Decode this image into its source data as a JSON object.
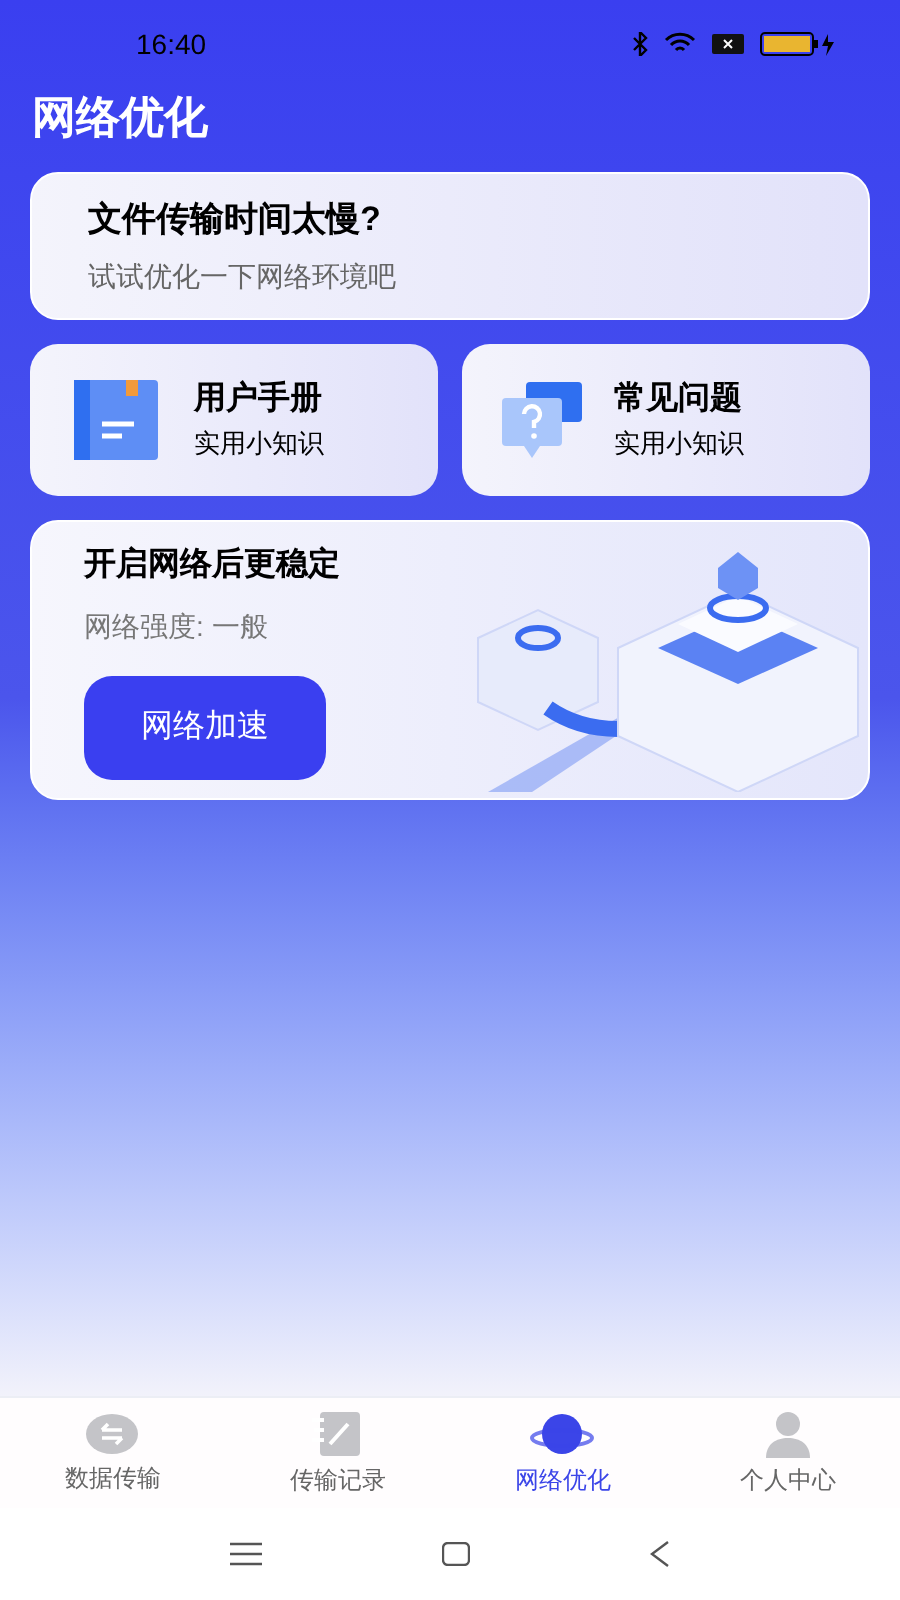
{
  "status_bar": {
    "time": "16:40"
  },
  "title": "网络优化",
  "tip_card": {
    "title": "文件传输时间太慢?",
    "subtitle": "试试优化一下网络环境吧"
  },
  "shortcuts": [
    {
      "kind": "manual",
      "title": "用户手册",
      "subtitle": "实用小知识"
    },
    {
      "kind": "faq",
      "title": "常见问题",
      "subtitle": "实用小知识"
    }
  ],
  "boost_card": {
    "title": "开启网络后更稳定",
    "strength": "网络强度: 一般",
    "button": "网络加速"
  },
  "tabs": [
    {
      "kind": "transfer",
      "label": "数据传输",
      "selected": false
    },
    {
      "kind": "records",
      "label": "传输记录",
      "selected": false
    },
    {
      "kind": "planet",
      "label": "网络优化",
      "selected": true
    },
    {
      "kind": "person",
      "label": "个人中心",
      "selected": false
    }
  ]
}
